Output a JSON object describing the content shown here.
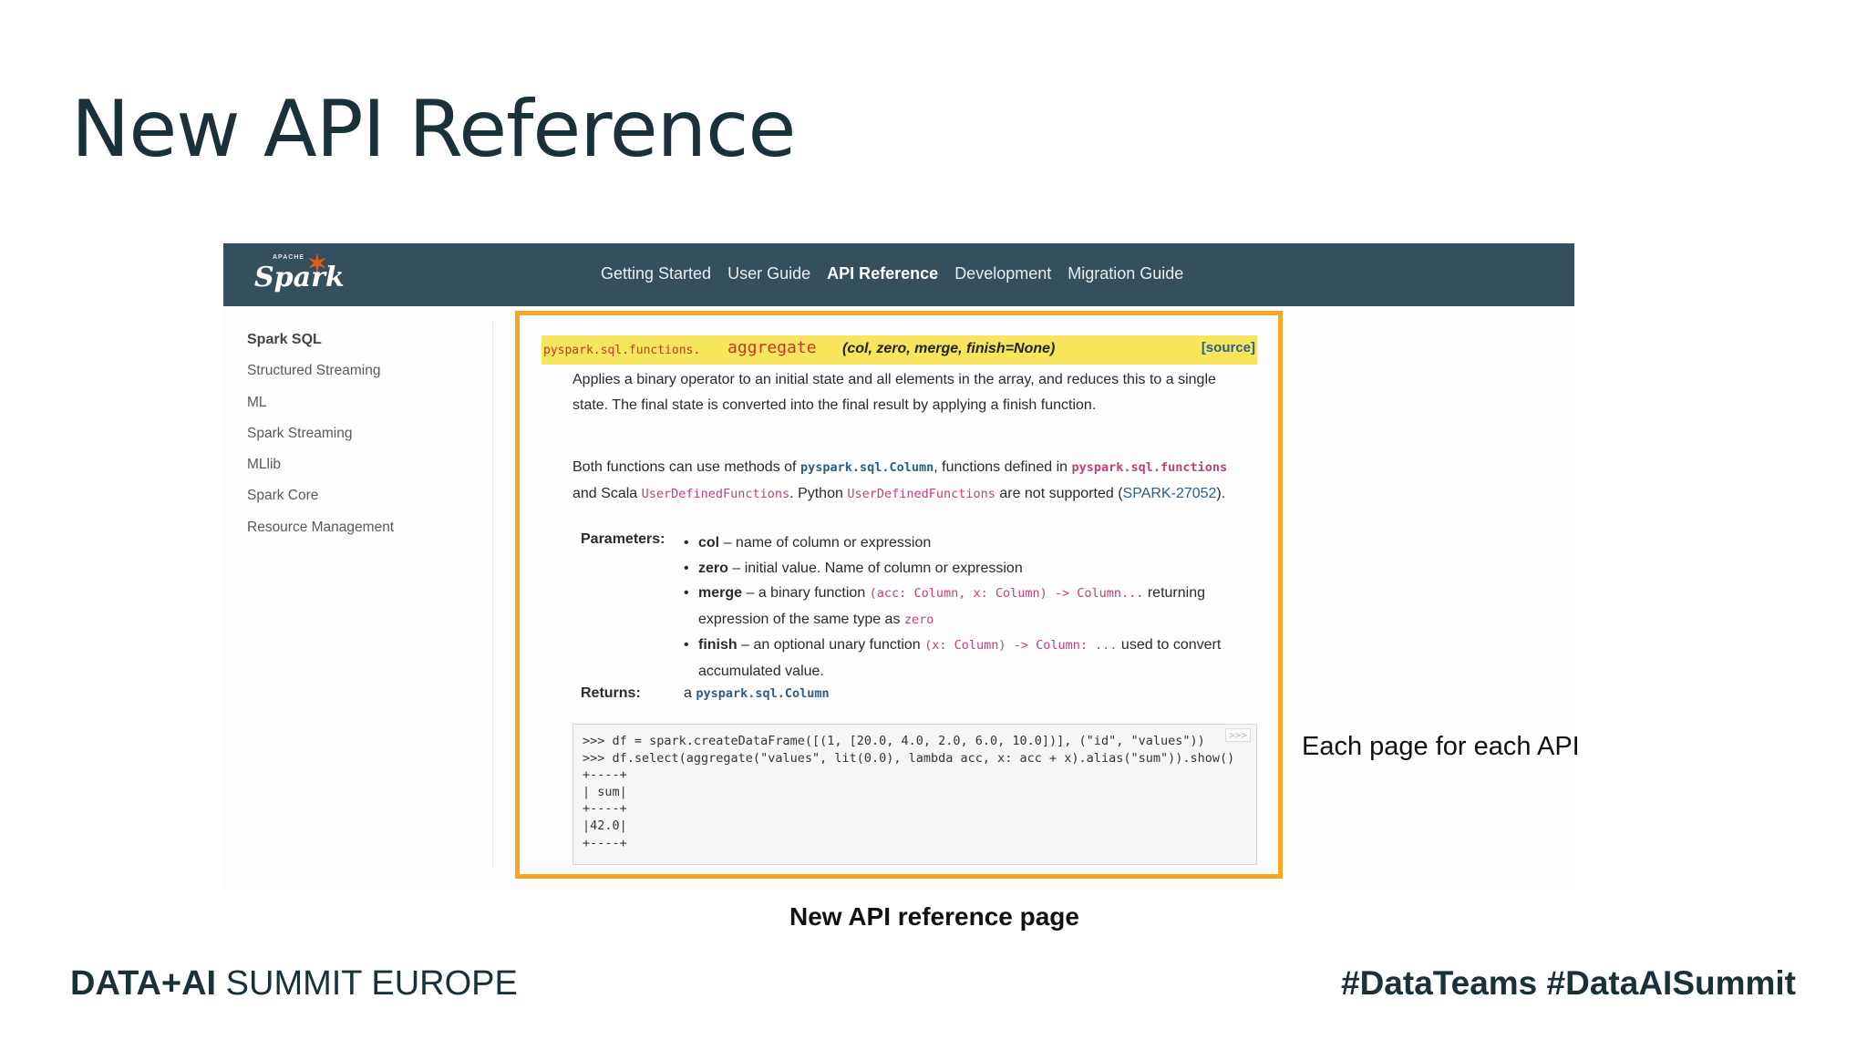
{
  "slide": {
    "title": "New API Reference",
    "side_note": "Each page for each API",
    "caption": "New API reference page",
    "footer_brand_bold": "DATA+AI",
    "footer_brand_rest": " SUMMIT EUROPE",
    "hashtags": "#DataTeams  #DataAISummit"
  },
  "site": {
    "logo_small": "APACHE",
    "logo_word": "Spark",
    "nav": [
      "Getting Started",
      "User Guide",
      "API Reference",
      "Development",
      "Migration Guide"
    ],
    "active_nav": "API Reference",
    "sidebar": [
      "Spark SQL",
      "Structured Streaming",
      "ML",
      "Spark Streaming",
      "MLlib",
      "Spark Core",
      "Resource Management"
    ]
  },
  "doc": {
    "module": "pyspark.sql.functions.",
    "function": "aggregate",
    "args": "(col, zero, merge, finish=None)",
    "source_link": "[source]",
    "description": "Applies a binary operator to an initial state and all elements in the array, and reduces this to a single state. The final state is converted into the final result by applying a finish function.",
    "note": {
      "t1": "Both functions can use methods of ",
      "c1": "pyspark.sql.Column",
      "t2": ", functions defined in ",
      "c2": "pyspark.sql.functions",
      "t3": " and Scala ",
      "c3": "UserDefinedFunctions",
      "t4": ". Python ",
      "c4": "UserDefinedFunctions",
      "t5": " are not supported (",
      "link": "SPARK-27052",
      "t6": ")."
    },
    "parameters_label": "Parameters:",
    "params": [
      {
        "name": "col",
        "desc": " – name of column or expression"
      },
      {
        "name": "zero",
        "desc": " – initial value. Name of column or expression"
      },
      {
        "name": "merge",
        "desc": " – a binary function ",
        "code": "(acc: Column, x: Column) -> Column...",
        "desc2": " returning expression of the same type as ",
        "code2": "zero"
      },
      {
        "name": "finish",
        "desc": " – an optional unary function ",
        "code": "(x: Column) -> Column: ...",
        "desc2": " used to convert accumulated value."
      }
    ],
    "returns_label": "Returns:",
    "returns_prefix": "a ",
    "returns_type": "pyspark.sql.Column",
    "copy_button": ">>>",
    "example_code": ">>> df = spark.createDataFrame([(1, [20.0, 4.0, 2.0, 6.0, 10.0])], (\"id\", \"values\"))\n>>> df.select(aggregate(\"values\", lit(0.0), lambda acc, x: acc + x).alias(\"sum\")).show()\n+----+\n| sum|\n+----+\n|42.0|\n+----+"
  }
}
